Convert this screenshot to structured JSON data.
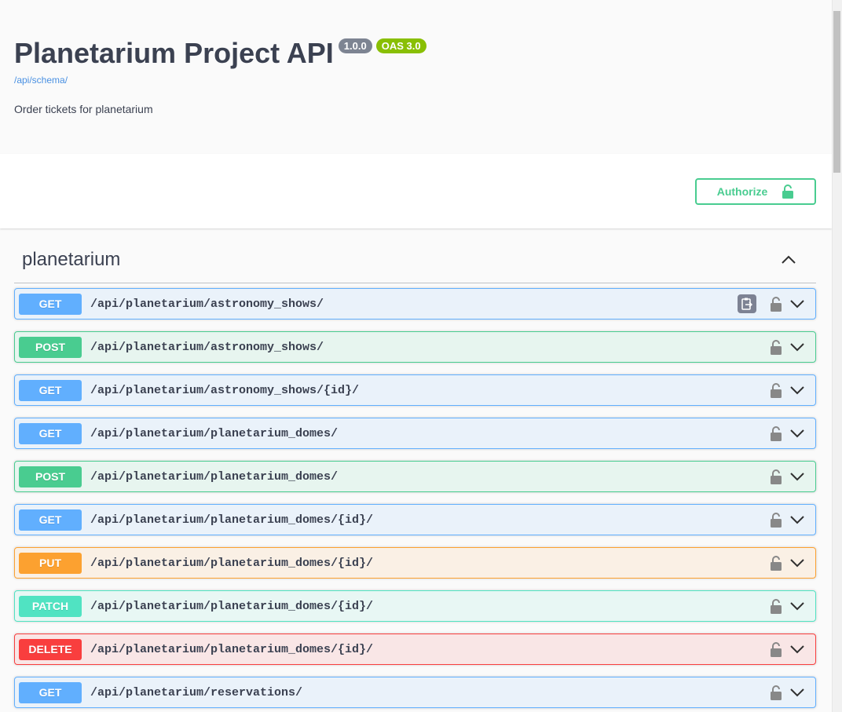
{
  "info": {
    "title": "Planetarium Project API",
    "version": "1.0.0",
    "oas_version": "OAS 3.0",
    "schema_link": "/api/schema/",
    "description": "Order tickets for planetarium"
  },
  "auth": {
    "authorize_label": "Authorize"
  },
  "tag": {
    "name": "planetarium"
  },
  "operations": [
    {
      "method": "GET",
      "path": "/api/planetarium/astronomy_shows/"
    },
    {
      "method": "POST",
      "path": "/api/planetarium/astronomy_shows/"
    },
    {
      "method": "GET",
      "path": "/api/planetarium/astronomy_shows/{id}/"
    },
    {
      "method": "GET",
      "path": "/api/planetarium/planetarium_domes/"
    },
    {
      "method": "POST",
      "path": "/api/planetarium/planetarium_domes/"
    },
    {
      "method": "GET",
      "path": "/api/planetarium/planetarium_domes/{id}/"
    },
    {
      "method": "PUT",
      "path": "/api/planetarium/planetarium_domes/{id}/"
    },
    {
      "method": "PATCH",
      "path": "/api/planetarium/planetarium_domes/{id}/"
    },
    {
      "method": "DELETE",
      "path": "/api/planetarium/planetarium_domes/{id}/"
    },
    {
      "method": "GET",
      "path": "/api/planetarium/reservations/"
    }
  ],
  "colors": {
    "get": "#61affe",
    "post": "#49cc90",
    "put": "#fca130",
    "patch": "#50e3c2",
    "delete": "#f93e3e",
    "text": "#3b4151",
    "link": "#4990e2"
  },
  "icons": {
    "authorize": "unlocked-padlock-icon",
    "operation_lock": "unlocked-padlock-icon",
    "expand": "chevron-down-icon",
    "collapse": "chevron-up-icon",
    "copy": "copy-to-clipboard-icon"
  }
}
